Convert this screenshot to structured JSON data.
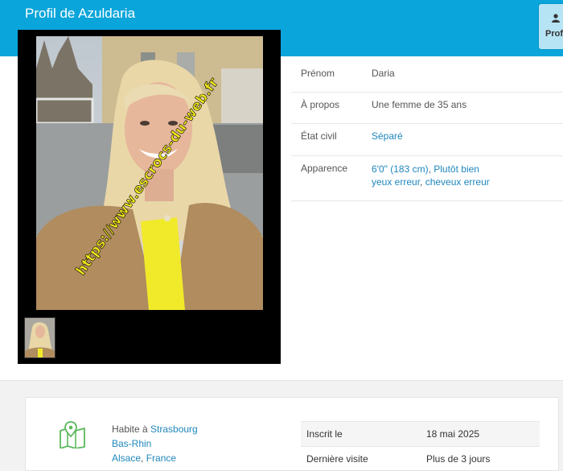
{
  "header": {
    "title": "Profil de Azuldaria",
    "tab_label": "Profil"
  },
  "watermark": "https://www.escrocs-du-web.fr",
  "profile": {
    "rows": [
      {
        "label": "Prénom",
        "value": "Daria"
      },
      {
        "label": "À propos",
        "value": "Une femme de 35 ans"
      },
      {
        "label": "État civil",
        "value": "Séparé"
      },
      {
        "label": "Apparence",
        "height": "6'0\" (183 cm)",
        "build": "Plutôt bien",
        "eyes": "yeux erreur",
        "sep": ", ",
        "hair": "cheveux erreur"
      }
    ]
  },
  "location": {
    "prefix": "Habite à ",
    "city": "Strasbourg",
    "region": "Bas-Rhin",
    "area": "Alsace",
    "sep": ", ",
    "country": "France"
  },
  "stats": [
    {
      "label": "Inscrit le",
      "value": "18 mai 2025"
    },
    {
      "label": "Dernière visite",
      "value": "Plus de 3 jours"
    }
  ],
  "colors": {
    "header_bg": "#0aa5db",
    "link": "#1f87bd",
    "icon_green": "#5cb85c"
  },
  "icons": {
    "tab": "user-icon",
    "location": "map-pin-icon"
  }
}
